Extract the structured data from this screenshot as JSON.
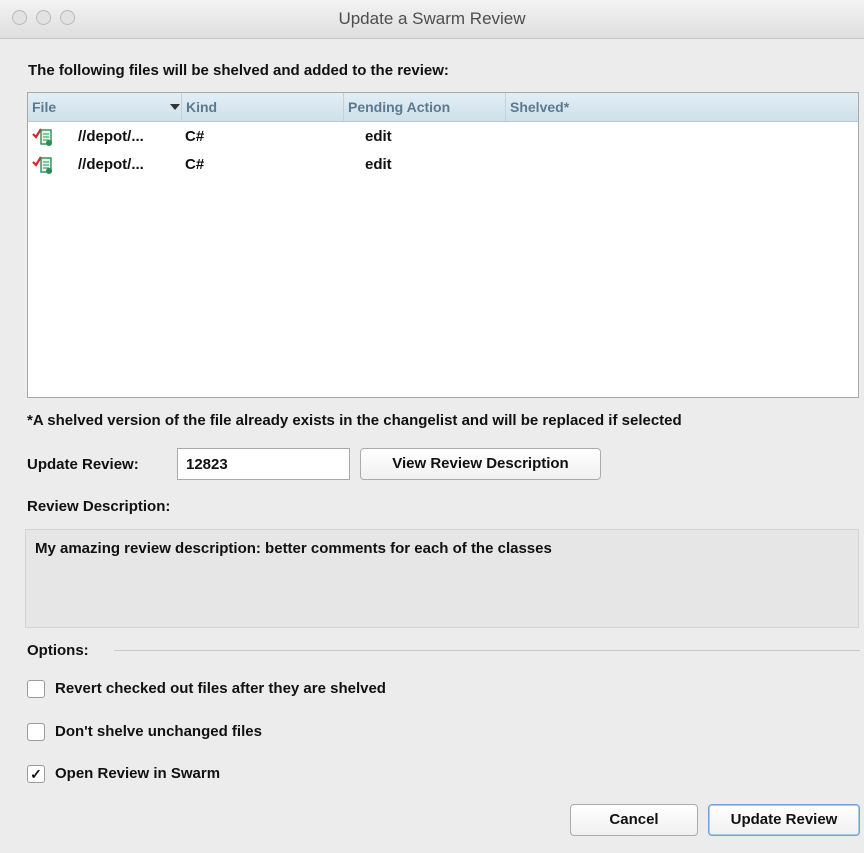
{
  "window": {
    "title": "Update a Swarm Review"
  },
  "heading": "The following files will be shelved and added to the review:",
  "table": {
    "columns": [
      "File",
      "Kind",
      "Pending Action",
      "Shelved*"
    ],
    "rows": [
      {
        "file": "//depot/...",
        "kind": "C#",
        "action": "edit",
        "shelved": ""
      },
      {
        "file": "//depot/...",
        "kind": "C#",
        "action": "edit",
        "shelved": ""
      }
    ]
  },
  "footnote": "*A shelved version of the file already exists in the changelist and will be replaced if selected",
  "update_review": {
    "label": "Update Review:",
    "value": "12823",
    "view_button": "View Review Description"
  },
  "review_description": {
    "label": "Review Description:",
    "text": "My amazing review description: better comments for each of the classes"
  },
  "options": {
    "label": "Options:",
    "items": [
      {
        "label": "Revert checked out files after they are shelved",
        "checked": false
      },
      {
        "label": "Don't shelve unchanged files",
        "checked": false
      },
      {
        "label": "Open Review in Swarm",
        "checked": true
      }
    ],
    "check_mark": "✓"
  },
  "buttons": {
    "cancel": "Cancel",
    "update": "Update Review"
  },
  "colors": {
    "table_header": "#d6e6ef",
    "icon_check": "#d62626",
    "icon_doc": "#2e8b57"
  }
}
